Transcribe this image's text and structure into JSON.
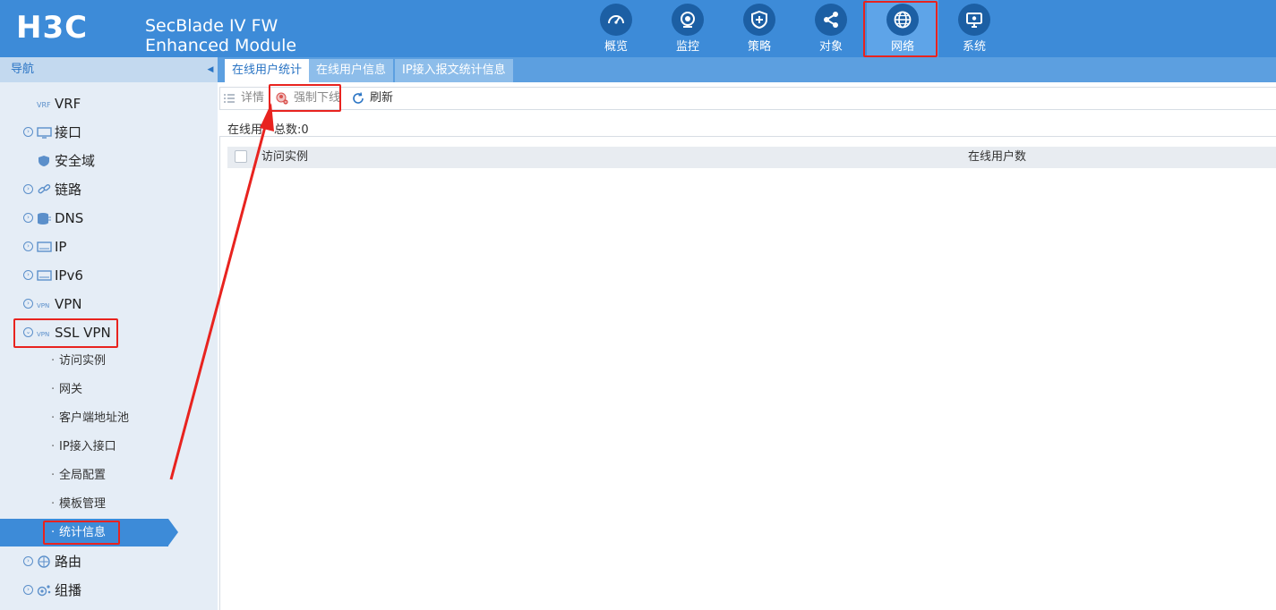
{
  "header": {
    "logo_text": "H3C",
    "product_line1": "SecBlade IV FW",
    "product_line2": "Enhanced Module",
    "nav": [
      {
        "label": "概览",
        "icon": "dashboard-icon"
      },
      {
        "label": "监控",
        "icon": "camera-icon"
      },
      {
        "label": "策略",
        "icon": "shield-plus-icon"
      },
      {
        "label": "对象",
        "icon": "share-nodes-icon"
      },
      {
        "label": "网络",
        "icon": "globe-icon",
        "active": true
      },
      {
        "label": "系统",
        "icon": "monitor-settings-icon"
      }
    ]
  },
  "sidebar": {
    "title": "导航",
    "items": [
      {
        "label": "VRF",
        "icon": "vrf-icon"
      },
      {
        "label": "接口",
        "icon": "interface-icon"
      },
      {
        "label": "安全域",
        "icon": "security-zone-icon"
      },
      {
        "label": "链路",
        "icon": "link-icon"
      },
      {
        "label": "DNS",
        "icon": "dns-icon"
      },
      {
        "label": "IP",
        "icon": "ip-icon"
      },
      {
        "label": "IPv6",
        "icon": "ipv6-icon"
      },
      {
        "label": "VPN",
        "icon": "vpn-icon"
      },
      {
        "label": "SSL VPN",
        "icon": "ssl-vpn-icon",
        "expanded": true
      },
      {
        "label": "路由",
        "icon": "route-icon"
      },
      {
        "label": "组播",
        "icon": "multicast-icon"
      }
    ],
    "ssl_vpn_children": [
      {
        "label": "访问实例"
      },
      {
        "label": "网关"
      },
      {
        "label": "客户端地址池"
      },
      {
        "label": "IP接入接口"
      },
      {
        "label": "全局配置"
      },
      {
        "label": "模板管理"
      },
      {
        "label": "统计信息",
        "active": true
      }
    ],
    "bullet": "·"
  },
  "tabs": [
    {
      "label": "在线用户统计",
      "active": true
    },
    {
      "label": "在线用户信息"
    },
    {
      "label": "IP接入报文统计信息"
    }
  ],
  "toolbar": {
    "details_label": "详情",
    "force_offline_label": "强制下线",
    "refresh_label": "刷新"
  },
  "summary": {
    "online_total_label": "在线用户总数:",
    "online_total_value": "0"
  },
  "table": {
    "columns": [
      "访问实例",
      "在线用户数"
    ],
    "rows": []
  },
  "colors": {
    "header_bg": "#3d8bd8",
    "nav_active": "#5ea4e8",
    "sidebar_bg": "#e5edf6",
    "highlight": "#e8231f"
  }
}
